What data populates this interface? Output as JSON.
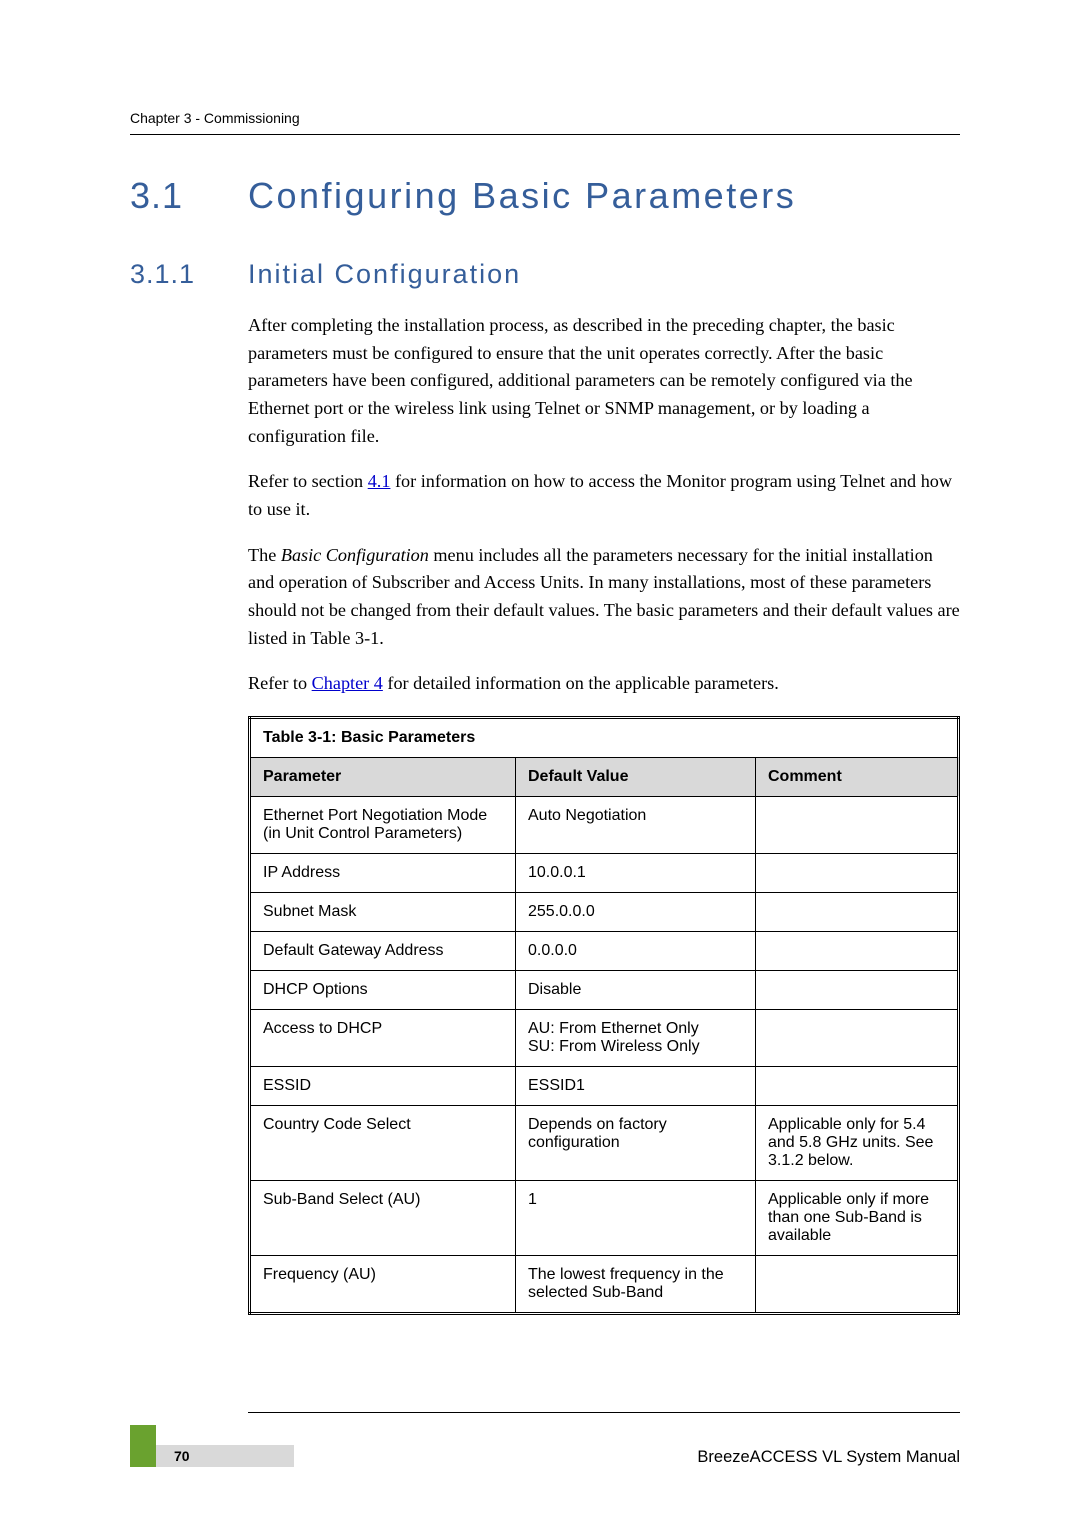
{
  "header": {
    "running": "Chapter 3 - Commissioning"
  },
  "h1": {
    "num": "3.1",
    "title": "Configuring Basic Parameters"
  },
  "h2": {
    "num": "3.1.1",
    "title": "Initial Configuration"
  },
  "paragraphs": {
    "p1": "After completing the installation process, as described in the preceding chapter, the basic parameters must be configured to ensure that the unit operates correctly. After the basic parameters have been configured, additional parameters can be remotely configured via the Ethernet port or the wireless link using Telnet or SNMP management, or by loading a configuration file.",
    "p2a": "Refer to section ",
    "p2link": "4.1",
    "p2b": " for information on how to access the Monitor program using Telnet and how to use it.",
    "p3a": "The ",
    "p3i": "Basic Configuration",
    "p3b": " menu includes all the parameters necessary for the initial installation and operation of Subscriber and Access Units. In many installations, most of these parameters should not be changed from their default values. The basic parameters and their default values are listed in Table 3-1.",
    "p4a": "Refer to ",
    "p4link": "Chapter 4",
    "p4b": " for detailed information on the applicable parameters."
  },
  "table": {
    "caption": "Table 3-1: Basic Parameters",
    "headers": {
      "param": "Parameter",
      "default": "Default Value",
      "comment": "Comment"
    },
    "rows": [
      {
        "param": "Ethernet Port Negotiation Mode (in Unit Control Parameters)",
        "default": "Auto Negotiation",
        "comment": ""
      },
      {
        "param": "IP Address",
        "default": "10.0.0.1",
        "comment": ""
      },
      {
        "param": "Subnet Mask",
        "default": "255.0.0.0",
        "comment": ""
      },
      {
        "param": "Default Gateway Address",
        "default": "0.0.0.0",
        "comment": ""
      },
      {
        "param": "DHCP Options",
        "default": "Disable",
        "comment": ""
      },
      {
        "param": "Access to DHCP",
        "default": "AU: From Ethernet Only\nSU: From Wireless Only",
        "comment": ""
      },
      {
        "param": "ESSID",
        "default": "ESSID1",
        "comment": ""
      },
      {
        "param": "Country Code Select",
        "default": "Depends on factory configuration",
        "comment": "Applicable only for 5.4 and 5.8 GHz units. See 3.1.2 below."
      },
      {
        "param": "Sub-Band Select (AU)",
        "default": "1",
        "comment": "Applicable only if more than one Sub-Band is available"
      },
      {
        "param": "Frequency (AU)",
        "default": "The lowest frequency in the selected Sub-Band",
        "comment": ""
      }
    ]
  },
  "footer": {
    "page": "70",
    "manual": "BreezeACCESS VL System Manual"
  }
}
